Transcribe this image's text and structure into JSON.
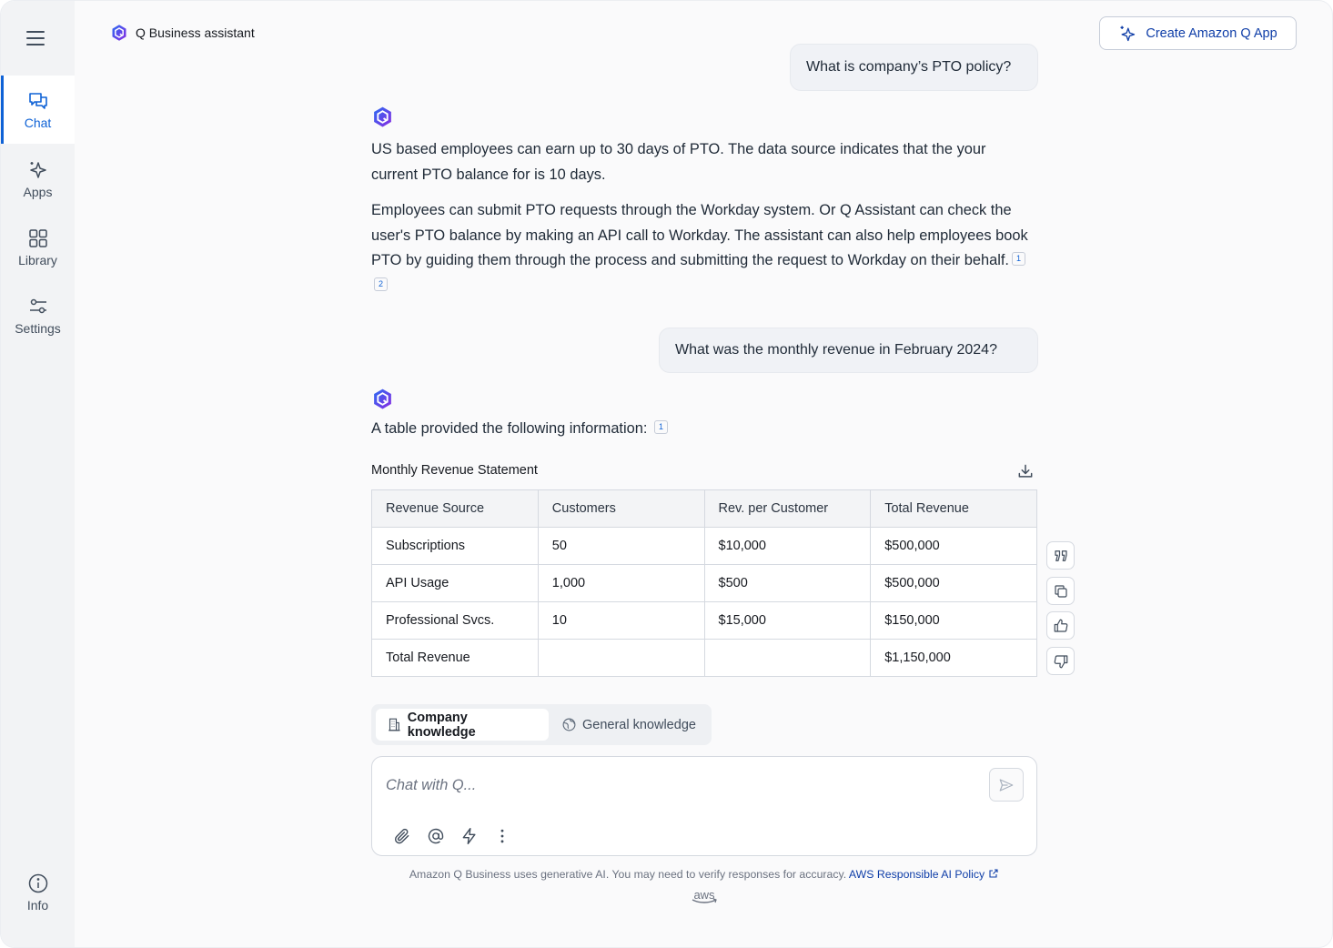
{
  "sidebar": {
    "items": [
      {
        "label": "Chat",
        "icon": "chat-icon"
      },
      {
        "label": "Apps",
        "icon": "sparkles-icon"
      },
      {
        "label": "Library",
        "icon": "grid-icon"
      },
      {
        "label": "Settings",
        "icon": "sliders-icon"
      }
    ],
    "info_label": "Info"
  },
  "header": {
    "title": "Q Business assistant",
    "create_button": "Create Amazon Q App"
  },
  "conversation": {
    "q1": "What is company’s PTO policy?",
    "a1_p1": "US based employees can earn up to 30 days of PTO. The data source indicates that the your current PTO balance for is 10 days.",
    "a1_p2": "Employees can submit PTO requests through the Workday system. Or Q Assistant can check the user's PTO balance by making an API call to Workday. The assistant can also help employees book PTO by guiding them through the process and submitting the request to Workday on their behalf.",
    "a1_cites": [
      "1",
      "2"
    ],
    "q2": "What was the monthly revenue in February 2024?",
    "a2_text": "A table provided the following information:",
    "a2_cites": [
      "1"
    ]
  },
  "table": {
    "title": "Monthly Revenue Statement",
    "headers": [
      "Revenue Source",
      "Customers",
      "Rev. per Customer",
      "Total Revenue"
    ],
    "rows": [
      [
        "Subscriptions",
        "50",
        "$10,000",
        "$500,000"
      ],
      [
        "API Usage",
        "1,000",
        "$500",
        "$500,000"
      ],
      [
        "Professional Svcs.",
        "10",
        "$15,000",
        "$150,000"
      ],
      [
        "Total Revenue",
        "",
        "",
        "$1,150,000"
      ]
    ]
  },
  "knowledge_toggle": {
    "company": "Company knowledge",
    "general": "General knowledge",
    "selected": "company"
  },
  "input": {
    "placeholder": "Chat with Q...",
    "value": ""
  },
  "footer": {
    "disclaimer": "Amazon Q Business uses generative AI. You may need to verify responses for accuracy.",
    "policy_link": "AWS Responsible AI Policy",
    "logo_text": "aws"
  },
  "colors": {
    "accent": "#0f62d6",
    "link": "#0f3ea8",
    "sidebar_bg": "#f2f3f5",
    "page_bg": "#fafafb"
  }
}
